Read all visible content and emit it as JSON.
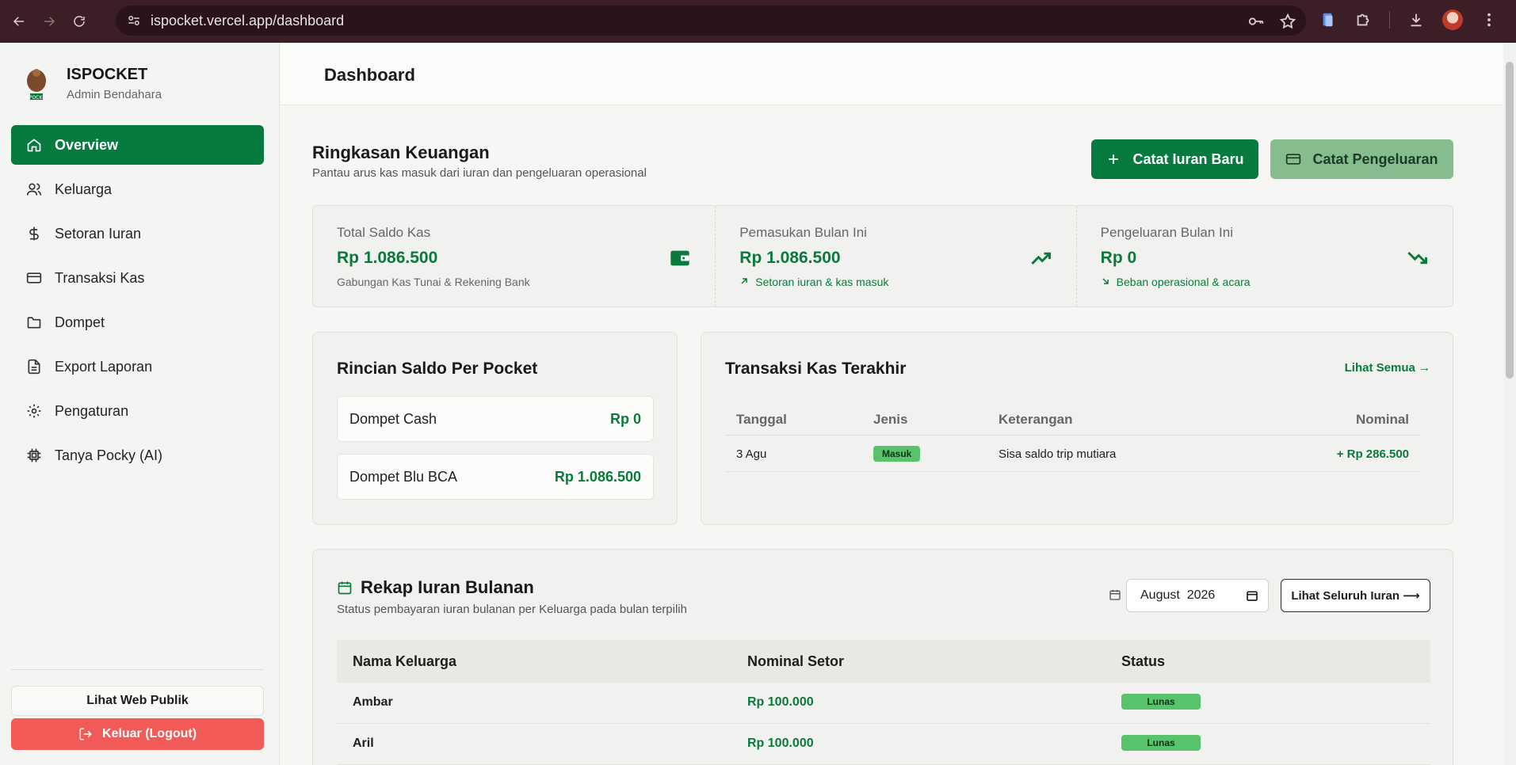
{
  "browser": {
    "url": "ispocket.vercel.app/dashboard"
  },
  "sidebar": {
    "brand_name": "ISPOCKET",
    "brand_role": "Admin Bendahara",
    "logo_text": "ISPOCKET",
    "items": [
      {
        "label": "Overview",
        "icon": "home-icon",
        "active": true
      },
      {
        "label": "Keluarga",
        "icon": "users-icon"
      },
      {
        "label": "Setoran Iuran",
        "icon": "dollar-icon"
      },
      {
        "label": "Transaksi Kas",
        "icon": "card-icon"
      },
      {
        "label": "Dompet",
        "icon": "folder-icon"
      },
      {
        "label": "Export Laporan",
        "icon": "document-icon"
      },
      {
        "label": "Pengaturan",
        "icon": "gear-icon"
      },
      {
        "label": "Tanya Pocky (AI)",
        "icon": "chip-icon"
      }
    ],
    "public_label": "Lihat Web Publik",
    "logout_label": "Keluar (Logout)"
  },
  "header": {
    "title": "Dashboard"
  },
  "summary": {
    "title": "Ringkasan Keuangan",
    "subtitle": "Pantau arus kas masuk dari iuran dan pengeluaran operasional",
    "btn_iuran": "Catat Iuran Baru",
    "btn_pengeluaran": "Catat Pengeluaran",
    "stats": [
      {
        "label": "Total Saldo Kas",
        "value": "Rp 1.086.500",
        "note": "Gabungan Kas Tunai & Rekening Bank",
        "icon": "wallet-icon"
      },
      {
        "label": "Pemasukan Bulan Ini",
        "value": "Rp 1.086.500",
        "note": "Setoran iuran & kas masuk",
        "icon": "trend-up-icon"
      },
      {
        "label": "Pengeluaran Bulan Ini",
        "value": "Rp 0",
        "note": "Beban operasional & acara",
        "icon": "trend-down-icon"
      }
    ]
  },
  "pockets": {
    "title": "Rincian Saldo Per Pocket",
    "items": [
      {
        "name": "Dompet Cash",
        "value": "Rp 0"
      },
      {
        "name": "Dompet Blu BCA",
        "value": "Rp 1.086.500"
      }
    ]
  },
  "transactions": {
    "title": "Transaksi Kas Terakhir",
    "see_all": "Lihat Semua →",
    "columns": [
      "Tanggal",
      "Jenis",
      "Keterangan",
      "Nominal"
    ],
    "rows": [
      {
        "tanggal": "3 Agu",
        "jenis": "Masuk",
        "keterangan": "Sisa saldo trip mutiara",
        "nominal": "+ Rp 286.500"
      }
    ]
  },
  "rekap": {
    "title": "Rekap Iuran Bulanan",
    "subtitle": "Status pembayaran iuran bulanan per Keluarga pada bulan terpilih",
    "month_value": "August  2026",
    "btn_all": "Lihat Seluruh Iuran ⟶",
    "columns": [
      "Nama Keluarga",
      "Nominal Setor",
      "Status"
    ],
    "rows": [
      {
        "nama": "Ambar",
        "nominal": "Rp 100.000",
        "status": "Lunas"
      },
      {
        "nama": "Aril",
        "nominal": "Rp 100.000",
        "status": "Lunas"
      }
    ]
  }
}
